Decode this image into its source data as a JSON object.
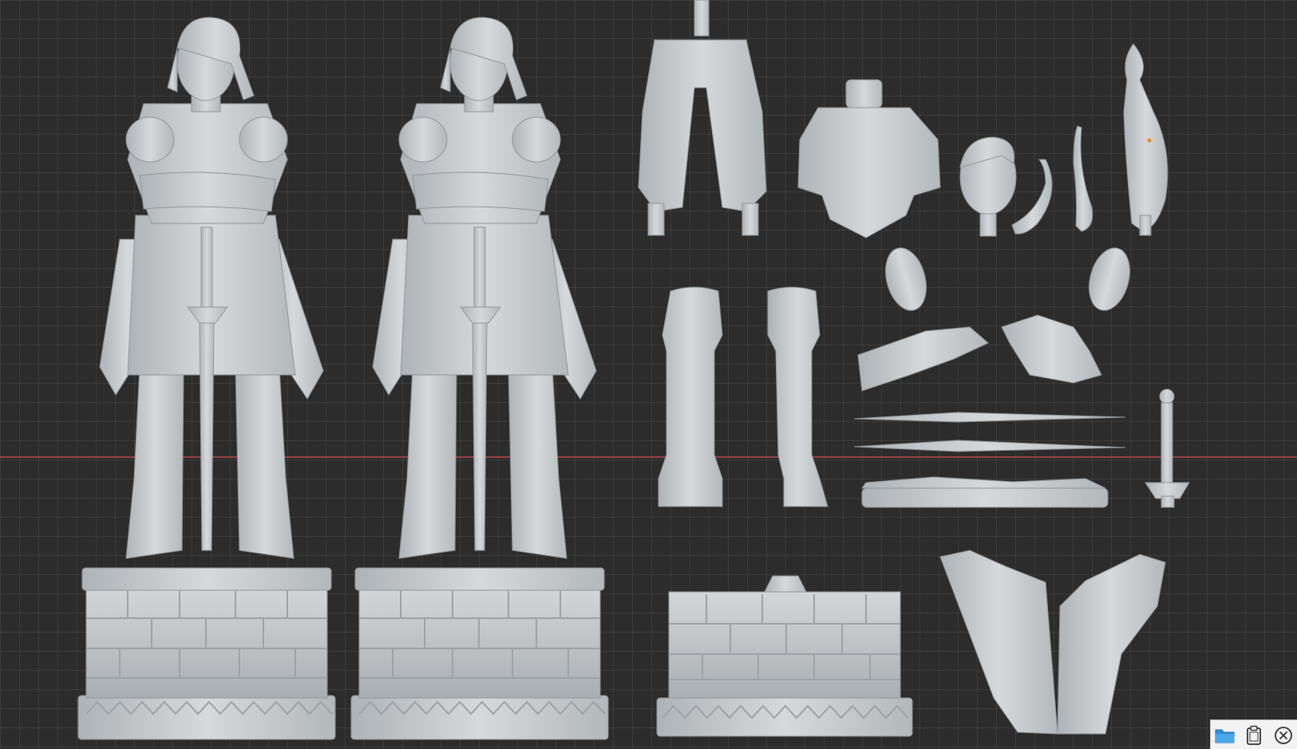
{
  "viewport": {
    "background": "#2c2c2c",
    "grid_color": "#3a3a3a",
    "axis_color": "#b94a4a",
    "model_color": "#c9cdd0"
  },
  "scene": {
    "objects": [
      "full-figure-assembled-left",
      "full-figure-assembled-right",
      "pants",
      "torso",
      "head",
      "hair-strands",
      "braid",
      "shoulder-pads",
      "boots",
      "hands",
      "sword-blades",
      "base-plate",
      "sword-hilt",
      "brick-pedestal",
      "cape"
    ]
  },
  "toolbar": {
    "buttons": [
      {
        "icon": "folder-icon",
        "color": "#2e8fd6"
      },
      {
        "icon": "clipboard-icon",
        "color": "#333333"
      },
      {
        "icon": "close-circle-icon",
        "color": "#333333"
      }
    ]
  }
}
